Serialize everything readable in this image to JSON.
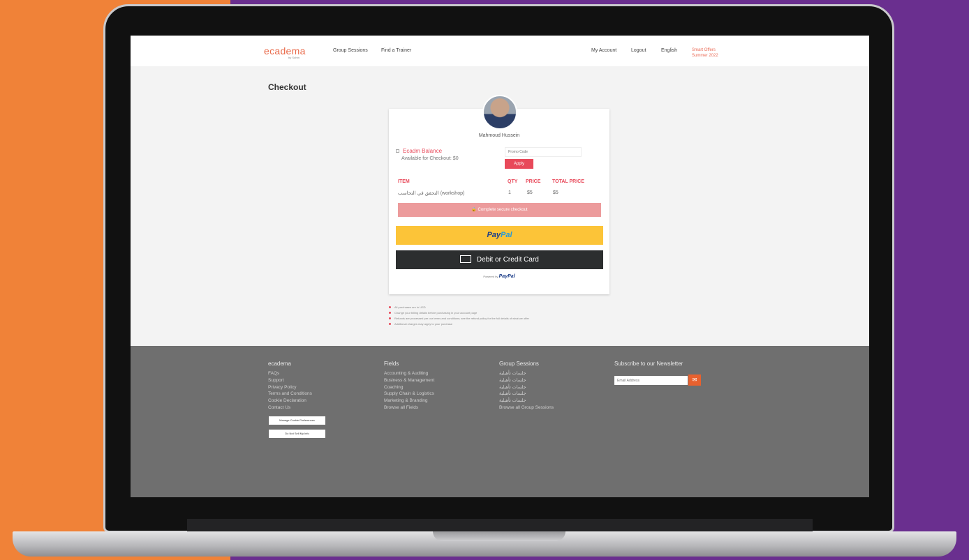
{
  "nav": {
    "logo": "ecadema",
    "logo_sub": "by Sohbt",
    "links": [
      "Group Sessions",
      "Find a Trainer"
    ],
    "right_links": [
      "My Account",
      "Logout",
      "English"
    ],
    "promo": [
      "Smart Offers",
      "Summer 2022"
    ]
  },
  "page": {
    "title": "Checkout"
  },
  "checkout": {
    "trainer_name": "Mahmoud Hussein",
    "credit_title": "Ecadm Balance",
    "credit_sub": "Available for Checkout: $0",
    "promo_placeholder": "Promo Code",
    "apply_label": "Apply",
    "table": {
      "headers": [
        "ITEM",
        "QTY",
        "PRICE",
        "TOTAL PRICE"
      ],
      "row": [
        "التحقق في التحاسب (workshop)",
        "1",
        "$5",
        "$5"
      ]
    },
    "complete_label": "Complete secure checkout",
    "paypal_label": [
      "Pay",
      "Pal"
    ],
    "card_label": "Debit or Credit Card",
    "powered_label": "Powered by",
    "powered_brand": "PayPal"
  },
  "notes": [
    "All purchases are in USD",
    "Change your billing details before purchasing in your account page",
    "Refunds are processed per our terms and conditions; see the refund policy for the full details of what we offer",
    "Additional charges may apply to your purchase"
  ],
  "footer": {
    "col1": {
      "head": "ecadema",
      "items": [
        "FAQs",
        "Support",
        "Privacy Policy",
        "Terms and Conditions",
        "Cookie Declaration",
        "Contact Us"
      ],
      "buttons": [
        "Manage Cookie Preferences",
        "Do Not Sell My Info"
      ]
    },
    "col2": {
      "head": "Fields",
      "items": [
        "Accounting & Auditing",
        "Business & Management",
        "Coaching",
        "Supply Chain & Logistics",
        "Marketing & Branding",
        "Browse all Fields"
      ]
    },
    "col3": {
      "head": "Group Sessions",
      "items": [
        "جلسات تأهيلية",
        "جلسات تأهيلية",
        "جلسات تأهيلية",
        "جلسات تأهيلية",
        "جلسات تأهيلية",
        "Browse all Group Sessions"
      ]
    },
    "col4": {
      "head": "Subscribe to our Newsletter",
      "placeholder": "Email Address"
    }
  }
}
